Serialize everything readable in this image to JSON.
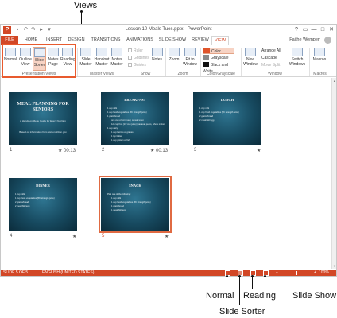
{
  "callouts": {
    "views": "Views",
    "normal": "Normal",
    "slide_sorter": "Slide Sorter",
    "reading": "Reading",
    "slide_show": "Slide Show"
  },
  "titlebar": {
    "title": "Lesson 10 Meals Tues.pptx - PowerPoint",
    "app_icon": "P",
    "qat": [
      "save-icon",
      "undo-icon",
      "redo-icon",
      "present-icon",
      "customize-icon"
    ],
    "window_buttons": [
      "?",
      "▭",
      "—",
      "□",
      "✕"
    ]
  },
  "tabs": [
    {
      "label": "FILE"
    },
    {
      "label": "HOME"
    },
    {
      "label": "INSERT"
    },
    {
      "label": "DESIGN"
    },
    {
      "label": "TRANSITIONS"
    },
    {
      "label": "ANIMATIONS"
    },
    {
      "label": "SLIDE SHOW"
    },
    {
      "label": "REVIEW"
    },
    {
      "label": "VIEW"
    }
  ],
  "user": "Faithe Wempen",
  "ribbon": {
    "presentation_views": {
      "label": "Presentation Views",
      "buttons": [
        {
          "label": "Normal"
        },
        {
          "label": "Outline View"
        },
        {
          "label": "Slide Sorter"
        },
        {
          "label": "Notes Page"
        },
        {
          "label": "Reading View"
        }
      ]
    },
    "master_views": {
      "label": "Master Views",
      "buttons": [
        {
          "label": "Slide Master"
        },
        {
          "label": "Handout Master"
        },
        {
          "label": "Notes Master"
        }
      ]
    },
    "show": {
      "label": "Show",
      "options": [
        "Ruler",
        "Gridlines",
        "Guides"
      ],
      "notes": "Notes"
    },
    "zoom": {
      "label": "Zoom",
      "buttons": [
        {
          "label": "Zoom"
        },
        {
          "label": "Fit to Window"
        }
      ]
    },
    "color": {
      "label": "Color/Grayscale",
      "options": [
        {
          "label": "Color",
          "swatch": "#e0542b"
        },
        {
          "label": "Grayscale",
          "swatch": "#8a8a8a"
        },
        {
          "label": "Black and White",
          "swatch": "#111111"
        }
      ]
    },
    "window": {
      "label": "Window",
      "new_window": "New Window",
      "options": [
        "Arrange All",
        "Cascade",
        "Move Split"
      ],
      "switch": "Switch Windows"
    },
    "macros": {
      "label": "Macros",
      "button": "Macros"
    }
  },
  "slides": [
    {
      "num": "1",
      "title": "MEAL PLANNING FOR SENIORS",
      "subtitle": "A Hands-on Menu Guide for Every Nutrition",
      "footer": "Based on information from www.nutrition.gov",
      "timing": "00:13",
      "bullets": []
    },
    {
      "num": "2",
      "title": "BREAKFAST",
      "timing": "00:13",
      "bullets": [
        {
          "t": "1 cup milk",
          "l": 1
        },
        {
          "t": "1 cup fresh vegetables (5K strength juice)",
          "l": 1
        },
        {
          "t": "1 grain/bread",
          "l": 1
        },
        {
          "t": "one cup of cornmeal, cereal, toast",
          "l": 2
        },
        {
          "t": "1/2 cup fruit (1/2 cup juice) (banana, pears, whole melon)",
          "l": 2
        },
        {
          "t": "1 cup dairy",
          "l": 1
        },
        {
          "t": "1 cup berries or grapes",
          "l": 2
        },
        {
          "t": "1 tsp butter",
          "l": 2
        },
        {
          "t": "1 cup protein or fish",
          "l": 2
        }
      ]
    },
    {
      "num": "3",
      "title": "LUNCH",
      "timing": "",
      "bullets": [
        {
          "t": "1 cup milk",
          "l": 1
        },
        {
          "t": "1 cup fresh vegetables (5K strength juice)",
          "l": 1
        },
        {
          "t": "2 grains/bread",
          "l": 1
        },
        {
          "t": "2 meat/fish/egg",
          "l": 1
        }
      ]
    },
    {
      "num": "4",
      "title": "DINNER",
      "timing": "",
      "bullets": [
        {
          "t": "1 cup milk",
          "l": 1
        },
        {
          "t": "1 cup fresh vegetables (5K strength juice)",
          "l": 1
        },
        {
          "t": "2 grains/bread",
          "l": 1
        },
        {
          "t": "2 meat/fish/egg",
          "l": 1
        }
      ]
    },
    {
      "num": "5",
      "title": "SNACK",
      "timing": "",
      "bullets": [
        {
          "t": "Pick one of the following:",
          "l": 1
        },
        {
          "t": "1 cup milk",
          "l": 2
        },
        {
          "t": "1 cup fresh vegetables (5K strength juice)",
          "l": 2
        },
        {
          "t": "1 grain/bread",
          "l": 2
        },
        {
          "t": "1 meat/fish/egg",
          "l": 2
        }
      ]
    }
  ],
  "status": {
    "slide": "SLIDE 5 OF 5",
    "language": "ENGLISH (UNITED STATES)",
    "zoom": "100%"
  }
}
